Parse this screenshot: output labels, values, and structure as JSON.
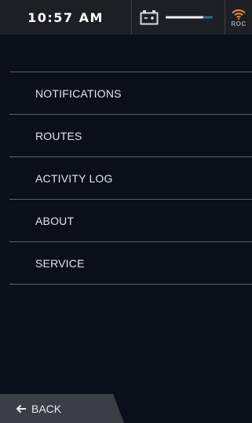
{
  "status_bar": {
    "time": "10:57 AM",
    "battery_icon": "battery-icon",
    "battery_level": 0.8,
    "roc_label": "ROC",
    "wifi_icon": "wifi-icon",
    "wifi_color": "#f08a24"
  },
  "menu": {
    "items": [
      {
        "label": "NOTIFICATIONS"
      },
      {
        "label": "ROUTES"
      },
      {
        "label": "ACTIVITY LOG"
      },
      {
        "label": "ABOUT"
      },
      {
        "label": "SERVICE"
      }
    ]
  },
  "footer": {
    "back_label": "BACK",
    "back_icon": "arrow-left-icon"
  },
  "colors": {
    "background": "#0b0f1a",
    "status_bar": "#1d1f24",
    "divider": "#5a5f6b",
    "back_button": "#3b3e45"
  }
}
